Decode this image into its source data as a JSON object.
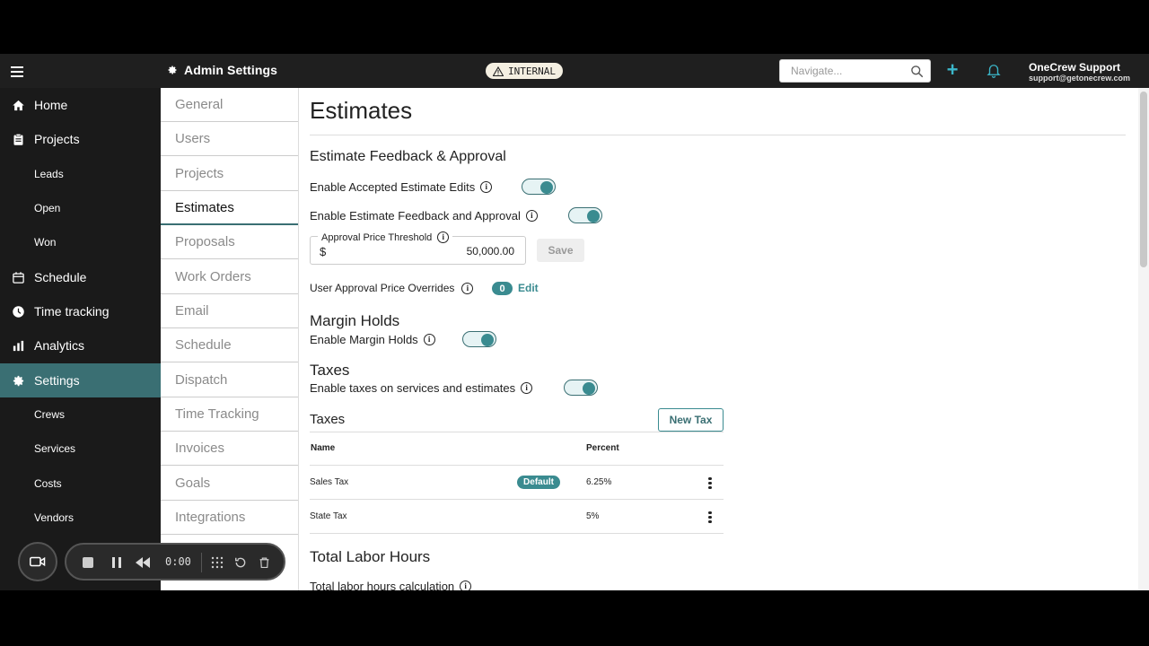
{
  "header": {
    "title": "Admin Settings",
    "env_badge": "INTERNAL",
    "search_placeholder": "Navigate...",
    "user_name": "OneCrew Support",
    "user_email": "support@getonecrew.com"
  },
  "sidebar": {
    "items": [
      {
        "label": "Home",
        "icon": "home-icon"
      },
      {
        "label": "Projects",
        "icon": "clipboard-icon"
      },
      {
        "label": "Leads"
      },
      {
        "label": "Open"
      },
      {
        "label": "Won"
      },
      {
        "label": "Schedule",
        "icon": "calendar-icon"
      },
      {
        "label": "Time tracking",
        "icon": "clock-icon"
      },
      {
        "label": "Analytics",
        "icon": "bar-chart-icon"
      },
      {
        "label": "Settings",
        "icon": "gear-icon",
        "active": true
      },
      {
        "label": "Crews"
      },
      {
        "label": "Services"
      },
      {
        "label": "Costs"
      },
      {
        "label": "Vendors"
      }
    ]
  },
  "recorder": {
    "time": "0:00"
  },
  "settings_nav": {
    "items": [
      "General",
      "Users",
      "Projects",
      "Estimates",
      "Proposals",
      "Work Orders",
      "Email",
      "Schedule",
      "Dispatch",
      "Time Tracking",
      "Invoices",
      "Goals",
      "Integrations"
    ],
    "active": "Estimates"
  },
  "main": {
    "title": "Estimates",
    "feedback": {
      "heading": "Estimate Feedback & Approval",
      "accepted_edits_label": "Enable Accepted Estimate Edits",
      "accepted_edits_on": true,
      "feedback_label": "Enable Estimate Feedback and Approval",
      "feedback_on": true,
      "threshold_label": "Approval Price Threshold",
      "threshold_currency": "$",
      "threshold_value": "50,000.00",
      "save_label": "Save",
      "overrides_label": "User Approval Price Overrides",
      "overrides_count": "0",
      "edit_label": "Edit"
    },
    "margin": {
      "heading": "Margin Holds",
      "label": "Enable Margin Holds",
      "on": true
    },
    "taxes": {
      "heading": "Taxes",
      "label": "Enable taxes on services and estimates",
      "on": true,
      "table_heading": "Taxes",
      "new_tax_label": "New Tax",
      "columns": [
        "Name",
        "Percent"
      ],
      "rows": [
        {
          "name": "Sales Tax",
          "badge": "Default",
          "percent": "6.25%"
        },
        {
          "name": "State Tax",
          "badge": "",
          "percent": "5%"
        }
      ]
    },
    "labor": {
      "heading": "Total Labor Hours",
      "calc_label": "Total labor hours calculation"
    }
  },
  "colors": {
    "accent": "#3a8b90",
    "sidebar_active": "#3a6f73",
    "sidebar_bg": "#1a1a1a",
    "topbar_bg": "#1f1f1f"
  }
}
